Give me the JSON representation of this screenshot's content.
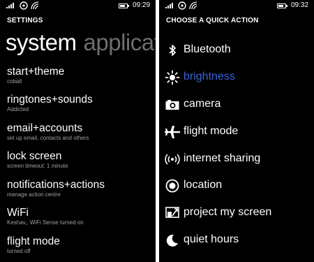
{
  "left_screen": {
    "status_bar": {
      "time": "09:29"
    },
    "header": "SETTINGS",
    "pivot": {
      "active": "system",
      "inactive": "applicat"
    },
    "items": [
      {
        "label": "start+theme",
        "subtitle": "cobalt"
      },
      {
        "label": "ringtones+sounds",
        "subtitle": "Addicted"
      },
      {
        "label": "email+accounts",
        "subtitle": "set up email, contacts and others"
      },
      {
        "label": "lock screen",
        "subtitle": "screen timeout: 1 minute"
      },
      {
        "label": "notifications+actions",
        "subtitle": "manage action centre"
      },
      {
        "label": "WiFi",
        "subtitle": "Keshav,, WiFi Sense turned on"
      },
      {
        "label": "flight mode",
        "subtitle": "turned off"
      }
    ]
  },
  "right_screen": {
    "status_bar": {
      "time": "09:32"
    },
    "header": "CHOOSE A QUICK ACTION",
    "items": [
      {
        "label": "Bluetooth",
        "icon": "bluetooth-icon"
      },
      {
        "label": "brightness",
        "icon": "brightness-icon",
        "selected": true
      },
      {
        "label": "camera",
        "icon": "camera-icon"
      },
      {
        "label": "flight mode",
        "icon": "airplane-icon"
      },
      {
        "label": "internet sharing",
        "icon": "internet-sharing-icon"
      },
      {
        "label": "location",
        "icon": "location-icon"
      },
      {
        "label": "project my screen",
        "icon": "project-screen-icon"
      },
      {
        "label": "quiet hours",
        "icon": "moon-icon"
      }
    ]
  },
  "colors": {
    "background": "#000000",
    "text": "#ffffff",
    "subtext": "#a0a0a0",
    "accent": "#3a63d8",
    "pivot_inactive": "#6e6e6e",
    "divider": "#ffffff"
  }
}
